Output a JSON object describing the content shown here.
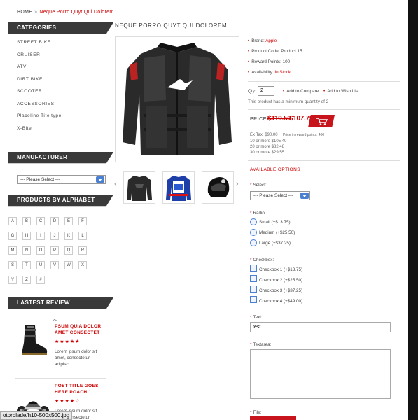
{
  "breadcrumb": {
    "home": "HOME",
    "current": "Neque Porro Quyt Qui Dolorem"
  },
  "sidebar": {
    "categories_title": "CATEGORIES",
    "categories": [
      "STREET BIKE",
      "CRUISER",
      "ATV",
      "DIRT BIKE",
      "SCOOTER",
      "ACCESSORIES",
      "Placeline Titeltype",
      "X-Bite"
    ],
    "manufacturer_title": "MANUFACTURER",
    "manufacturer_select": "--- Please Select ---",
    "alphabet_title": "PRODUCTS BY ALPHABET",
    "alphabet": [
      "A",
      "B",
      "C",
      "D",
      "E",
      "F",
      "G",
      "H",
      "I",
      "J",
      "K",
      "L",
      "M",
      "N",
      "O",
      "P",
      "Q",
      "R",
      "S",
      "T",
      "U",
      "V",
      "W",
      "X",
      "Y",
      "Z",
      "#"
    ],
    "review_title": "LASTEST REVIEW",
    "reviews": [
      {
        "title": "PSUM QUIA DOLOR AMET CONSECTET",
        "stars": "★★★★★",
        "text": "Lorem ipsum dolor sit amet, consectetur adipisci."
      },
      {
        "title": "POST TITLE GOES HERE POACH 1",
        "stars": "★★★★☆",
        "text": "Lorem ipsum dolor sit amet, consectetur"
      }
    ]
  },
  "product": {
    "title": "NEQUE PORRO QUYT QUI DOLOREM",
    "brand_label": "Brand:",
    "brand_value": "Apple",
    "code": "Product Code: Product 15",
    "reward": "Reward Points: 100",
    "availability_label": "Availability:",
    "availability_value": "In Stock",
    "qty_label": "Qty:",
    "qty_value": "2",
    "add_compare": "Add to Compare",
    "add_wishlist": "Add to Wish List",
    "minimum_note": "This product has a minimum quantity of 2",
    "price_label": "PRICE:",
    "price_old": "$119.50",
    "price_new": "$107.75",
    "ex_tax": "Ex Tax: $90.00",
    "reward_points_note": "Price in reward points: 400",
    "discounts": [
      "10 or more $105.40",
      "20 or more $82.48",
      "30 or more $29.55"
    ]
  },
  "options": {
    "heading": "AVAILABLE OPTIONS",
    "select_label": "Select:",
    "select_value": "--- Please Select ---",
    "radio_label": "Radio:",
    "radios": [
      "Small (+$13.75)",
      "Medium (+$25.50)",
      "Large (+$37.25)"
    ],
    "checkbox_label": "Checkbox:",
    "checkboxes": [
      "Checkbox 1 (+$13.75)",
      "Checkbox 2 (+$25.50)",
      "Checkbox 3 (+$37.25)",
      "Checkbox 4 (+$49.00)"
    ],
    "text_label": "Text:",
    "text_value": "test",
    "textarea_label": "Textarea:",
    "file_label": "File:"
  },
  "status_bar": {
    "url": "otorblade/h10-500x500.jpg"
  },
  "colors": {
    "accent": "#c00000",
    "dark_header": "#3a3a3a"
  }
}
